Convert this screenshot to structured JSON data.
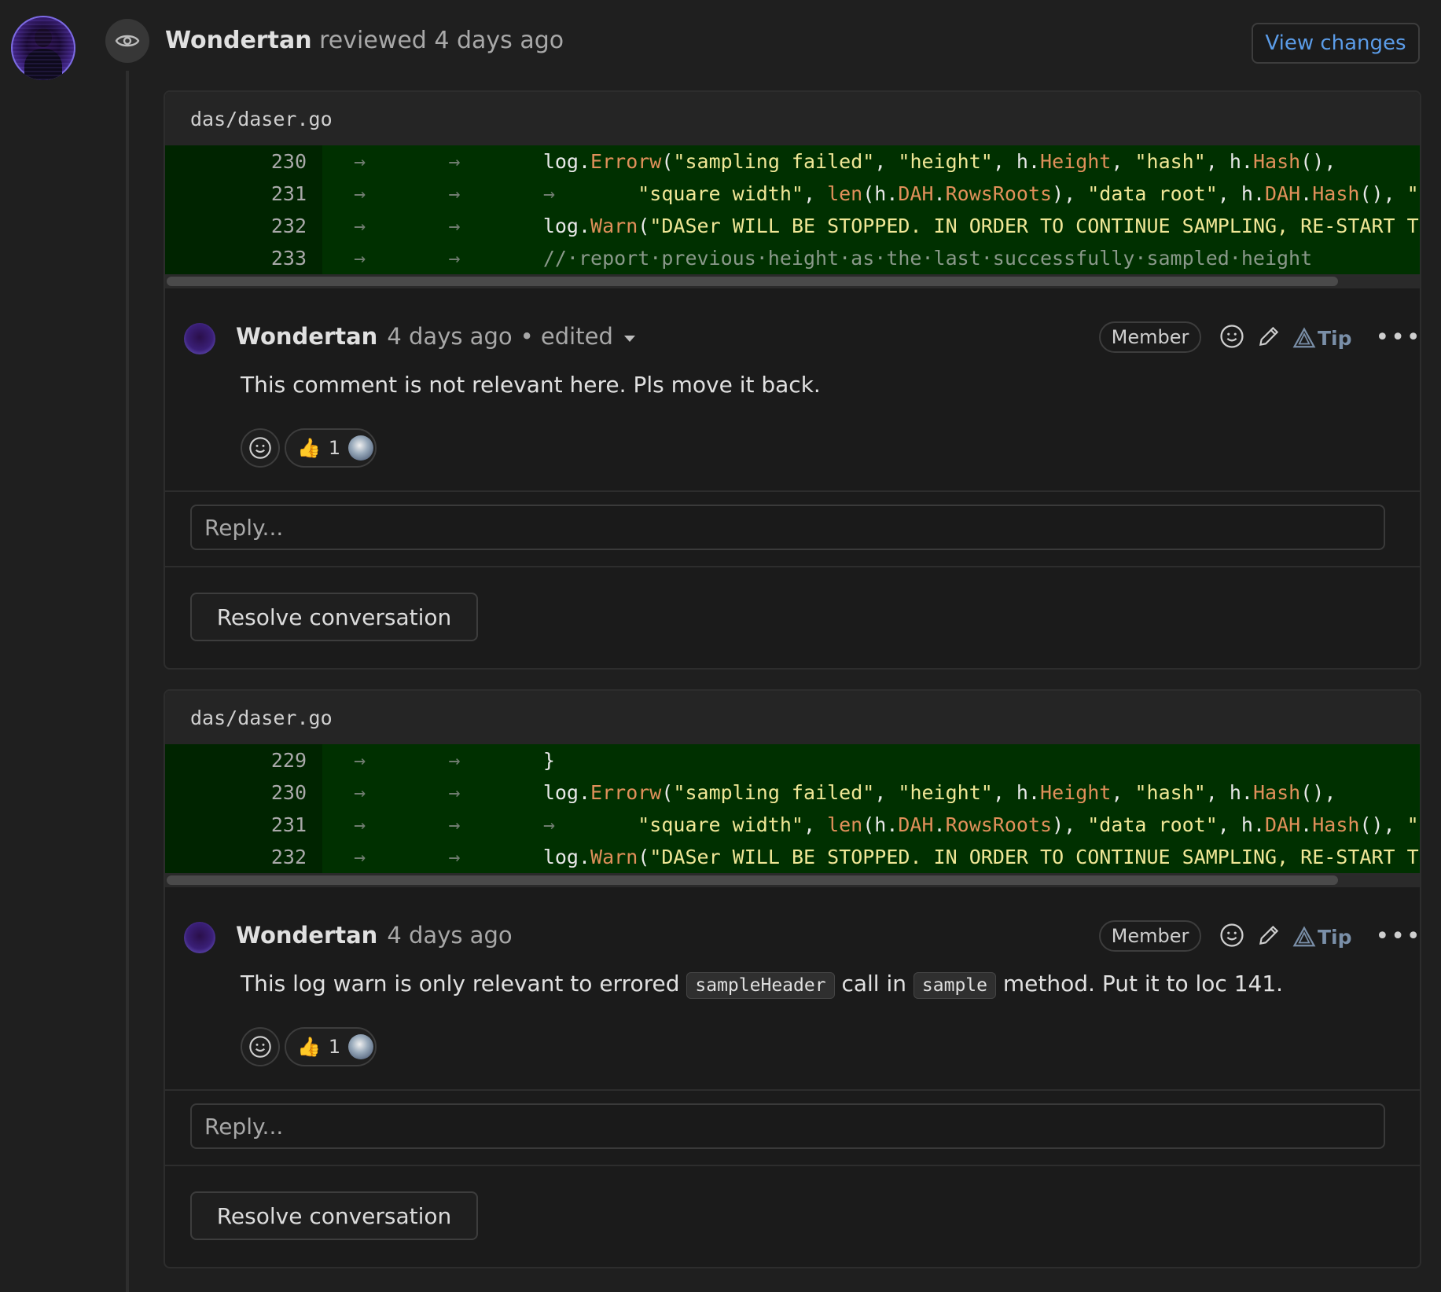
{
  "review": {
    "author": "Wondertan",
    "action": "reviewed",
    "time": "4 days ago",
    "view_changes_label": "View changes"
  },
  "threads": [
    {
      "file": "das/daser.go",
      "lines": [
        {
          "num": "230",
          "tokens": [
            [
              "a",
              "→       →       "
            ],
            [
              "p",
              "log."
            ],
            [
              "f",
              "Errorw"
            ],
            [
              "p",
              "("
            ],
            [
              "s",
              "\"sampling failed\""
            ],
            [
              "p",
              ", "
            ],
            [
              "s",
              "\"height\""
            ],
            [
              "p",
              ", h."
            ],
            [
              "f",
              "Height"
            ],
            [
              "p",
              ", "
            ],
            [
              "s",
              "\"hash\""
            ],
            [
              "p",
              ", h."
            ],
            [
              "f",
              "Hash"
            ],
            [
              "p",
              "(),"
            ]
          ]
        },
        {
          "num": "231",
          "tokens": [
            [
              "a",
              "→       →       →       "
            ],
            [
              "s",
              "\"square width\""
            ],
            [
              "p",
              ", "
            ],
            [
              "f",
              "len"
            ],
            [
              "p",
              "(h."
            ],
            [
              "f",
              "DAH"
            ],
            [
              "p",
              "."
            ],
            [
              "f",
              "RowsRoots"
            ],
            [
              "p",
              "), "
            ],
            [
              "s",
              "\"data root\""
            ],
            [
              "p",
              ", h."
            ],
            [
              "f",
              "DAH"
            ],
            [
              "p",
              "."
            ],
            [
              "f",
              "Hash"
            ],
            [
              "p",
              "(), "
            ],
            [
              "s",
              "\"err\""
            ]
          ]
        },
        {
          "num": "232",
          "tokens": [
            [
              "a",
              "→       →       "
            ],
            [
              "p",
              "log."
            ],
            [
              "f",
              "Warn"
            ],
            [
              "p",
              "("
            ],
            [
              "s",
              "\"DASer WILL BE STOPPED. IN ORDER TO CONTINUE SAMPLING, RE-START THE N"
            ]
          ]
        },
        {
          "num": "233",
          "tokens": [
            [
              "a",
              "→       →       "
            ],
            [
              "c",
              "//·report·previous·height·as·the·last·successfully·sampled·height"
            ]
          ]
        }
      ],
      "comment": {
        "author": "Wondertan",
        "time": "4 days ago",
        "edited": "• edited",
        "badge": "Member",
        "tip": "Tip",
        "body_parts": [
          [
            "t",
            "This comment is not relevant here. Pls move it back."
          ]
        ],
        "reaction_count": "1"
      },
      "reply_placeholder": "Reply...",
      "resolve_label": "Resolve conversation"
    },
    {
      "file": "das/daser.go",
      "lines": [
        {
          "num": "229",
          "tokens": [
            [
              "a",
              "→       →       "
            ],
            [
              "p",
              "}"
            ]
          ]
        },
        {
          "num": "230",
          "tokens": [
            [
              "a",
              "→       →       "
            ],
            [
              "p",
              "log."
            ],
            [
              "f",
              "Errorw"
            ],
            [
              "p",
              "("
            ],
            [
              "s",
              "\"sampling failed\""
            ],
            [
              "p",
              ", "
            ],
            [
              "s",
              "\"height\""
            ],
            [
              "p",
              ", h."
            ],
            [
              "f",
              "Height"
            ],
            [
              "p",
              ", "
            ],
            [
              "s",
              "\"hash\""
            ],
            [
              "p",
              ", h."
            ],
            [
              "f",
              "Hash"
            ],
            [
              "p",
              "(),"
            ]
          ]
        },
        {
          "num": "231",
          "tokens": [
            [
              "a",
              "→       →       →       "
            ],
            [
              "s",
              "\"square width\""
            ],
            [
              "p",
              ", "
            ],
            [
              "f",
              "len"
            ],
            [
              "p",
              "(h."
            ],
            [
              "f",
              "DAH"
            ],
            [
              "p",
              "."
            ],
            [
              "f",
              "RowsRoots"
            ],
            [
              "p",
              "), "
            ],
            [
              "s",
              "\"data root\""
            ],
            [
              "p",
              ", h."
            ],
            [
              "f",
              "DAH"
            ],
            [
              "p",
              "."
            ],
            [
              "f",
              "Hash"
            ],
            [
              "p",
              "(), "
            ],
            [
              "s",
              "\"err\""
            ]
          ]
        },
        {
          "num": "232",
          "tokens": [
            [
              "a",
              "→       →       "
            ],
            [
              "p",
              "log."
            ],
            [
              "f",
              "Warn"
            ],
            [
              "p",
              "("
            ],
            [
              "s",
              "\"DASer WILL BE STOPPED. IN ORDER TO CONTINUE SAMPLING, RE-START THE N"
            ]
          ]
        }
      ],
      "comment": {
        "author": "Wondertan",
        "time": "4 days ago",
        "edited": "",
        "badge": "Member",
        "tip": "Tip",
        "body_parts": [
          [
            "t",
            "This log warn is only relevant to errored "
          ],
          [
            "code",
            "sampleHeader"
          ],
          [
            "t",
            " call in "
          ],
          [
            "code",
            "sample"
          ],
          [
            "t",
            " method. Put it to loc 141."
          ]
        ],
        "reaction_count": "1"
      },
      "reply_placeholder": "Reply...",
      "resolve_label": "Resolve conversation"
    }
  ]
}
